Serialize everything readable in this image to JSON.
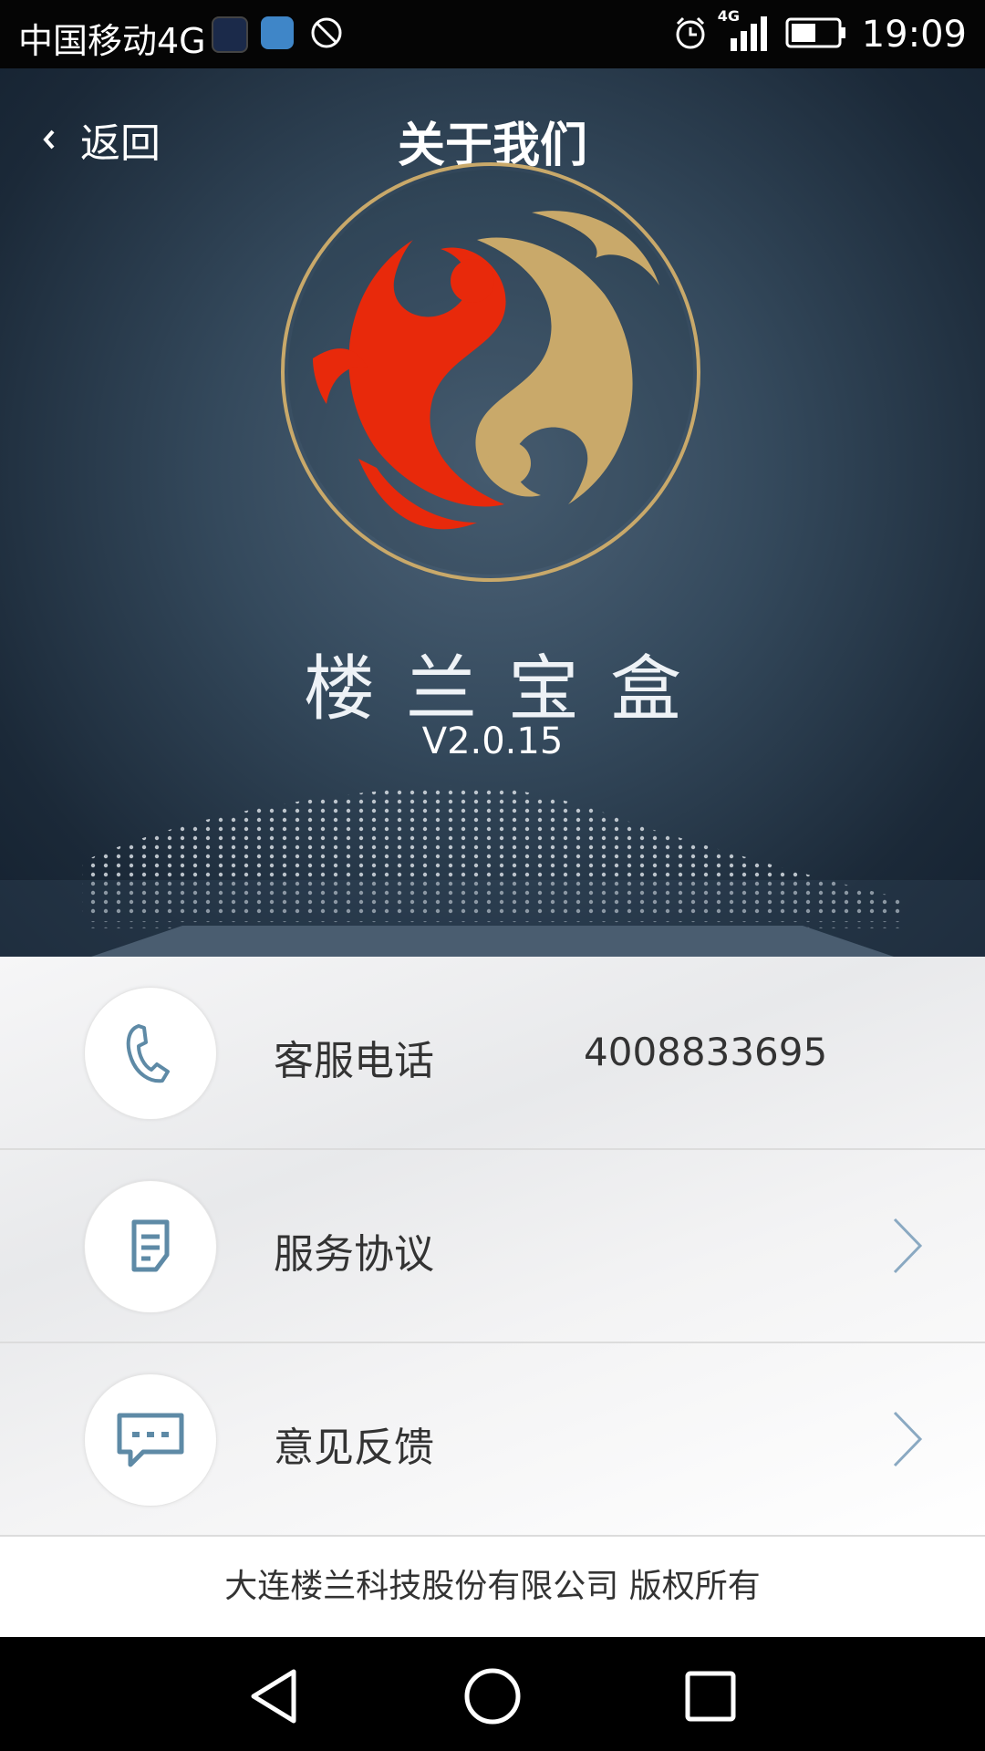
{
  "status_bar": {
    "carrier": "中国移动4G",
    "network": "4G",
    "time": "19:09",
    "icons": [
      "app-icon",
      "health-icon",
      "no-disturb-icon",
      "alarm-icon",
      "signal-icon",
      "battery-icon"
    ]
  },
  "header": {
    "back_label": "返回",
    "title": "关于我们"
  },
  "app": {
    "name": "楼兰宝盒",
    "version": "V2.0.15",
    "logo": "loulan-logo"
  },
  "list": {
    "items": [
      {
        "label": "客服电话",
        "value": "4008833695",
        "icon": "phone-icon"
      },
      {
        "label": "服务协议",
        "icon": "document-icon"
      },
      {
        "label": "意见反馈",
        "icon": "chat-icon"
      }
    ]
  },
  "footer": {
    "copyright": "大连楼兰科技股份有限公司  版权所有"
  },
  "colors": {
    "accent_red": "#e8290b",
    "accent_gold": "#c9a96a",
    "icon_blue": "#5e8aa6"
  }
}
